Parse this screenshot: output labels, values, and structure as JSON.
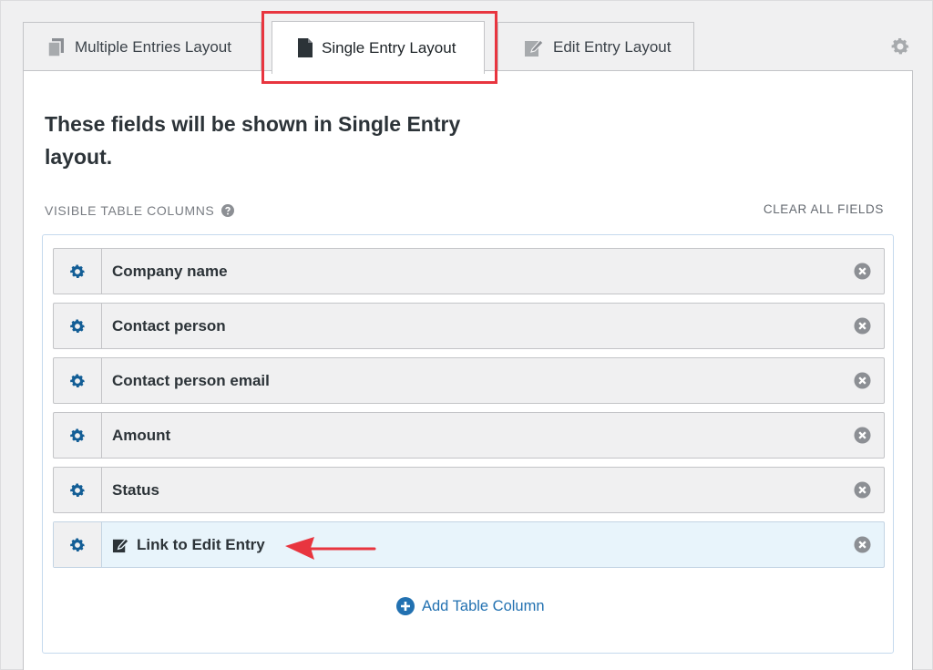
{
  "tabs": [
    {
      "label": "Multiple Entries Layout",
      "icon": "documents-icon"
    },
    {
      "label": "Single Entry Layout",
      "icon": "document-icon",
      "active": true
    },
    {
      "label": "Edit Entry Layout",
      "icon": "edit-document-icon"
    }
  ],
  "heading": "These fields will be shown in Single Entry layout.",
  "section_label": "VISIBLE TABLE COLUMNS",
  "clear_all": "CLEAR ALL FIELDS",
  "fields": [
    {
      "label": "Company name"
    },
    {
      "label": "Contact person"
    },
    {
      "label": "Contact person email"
    },
    {
      "label": "Amount"
    },
    {
      "label": "Status"
    },
    {
      "label": "Link to Edit Entry",
      "icon": "edit-icon",
      "highlighted": true
    }
  ],
  "add_column": "Add Table Column",
  "colors": {
    "accent": "#2271b1",
    "gear_blue": "#135e96",
    "highlight_red": "#e8353f",
    "active_row": "#e8f4fb"
  }
}
